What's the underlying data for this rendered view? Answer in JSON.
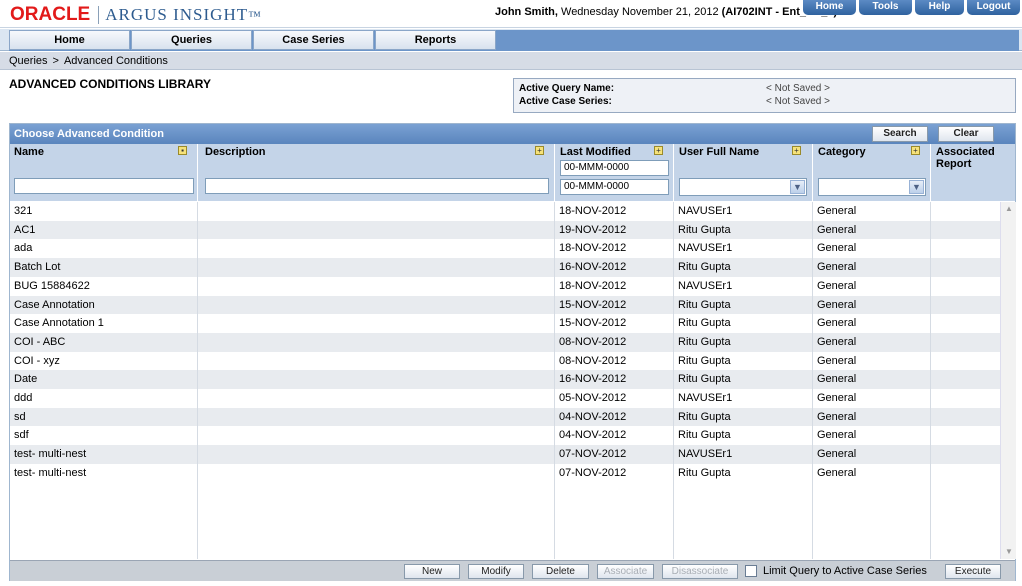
{
  "header": {
    "logo_oracle": "ORACLE",
    "logo_product": "ARGUS INSIGHT",
    "logo_tm": "™",
    "user_name": "John Smith,",
    "user_session": " Wednesday November 21, 2012 ",
    "user_env": "(AI702INT - Ent_SH_2)",
    "links": [
      "Home",
      "Tools",
      "Help",
      "Logout"
    ]
  },
  "nav": {
    "tabs": [
      "Home",
      "Queries",
      "Case Series",
      "Reports"
    ]
  },
  "breadcrumb": {
    "items": [
      "Queries",
      "Advanced Conditions"
    ],
    "separator": ">"
  },
  "page": {
    "title": "ADVANCED CONDITIONS LIBRARY"
  },
  "active_info": {
    "query_label": "Active Query Name:",
    "query_value": "< Not Saved >",
    "case_label": "Active Case Series:",
    "case_value": "< Not Saved >"
  },
  "panel": {
    "title": "Choose Advanced Condition",
    "search_label": "Search",
    "clear_label": "Clear"
  },
  "columns": {
    "name": "Name",
    "description": "Description",
    "last_modified": "Last Modified",
    "user_full_name": "User Full Name",
    "category": "Category",
    "associated_report_1": "Associated",
    "associated_report_2": "Report"
  },
  "filters": {
    "name_value": "",
    "description_value": "",
    "date_from": "00-MMM-0000",
    "date_to": "00-MMM-0000",
    "user_selected": "",
    "category_selected": ""
  },
  "rows": [
    {
      "name": "321",
      "description": "",
      "modified": "18-NOV-2012",
      "user": "NAVUSEr1",
      "category": "General",
      "report": ""
    },
    {
      "name": "AC1",
      "description": "",
      "modified": "19-NOV-2012",
      "user": "Ritu Gupta",
      "category": "General",
      "report": ""
    },
    {
      "name": "ada",
      "description": "",
      "modified": "18-NOV-2012",
      "user": "NAVUSEr1",
      "category": "General",
      "report": ""
    },
    {
      "name": "Batch Lot",
      "description": "",
      "modified": "16-NOV-2012",
      "user": "Ritu Gupta",
      "category": "General",
      "report": ""
    },
    {
      "name": "BUG 15884622",
      "description": "",
      "modified": "18-NOV-2012",
      "user": "NAVUSEr1",
      "category": "General",
      "report": ""
    },
    {
      "name": "Case Annotation",
      "description": "",
      "modified": "15-NOV-2012",
      "user": "Ritu Gupta",
      "category": "General",
      "report": ""
    },
    {
      "name": "Case Annotation 1",
      "description": "",
      "modified": "15-NOV-2012",
      "user": "Ritu Gupta",
      "category": "General",
      "report": ""
    },
    {
      "name": "COI - ABC",
      "description": "",
      "modified": "08-NOV-2012",
      "user": "Ritu Gupta",
      "category": "General",
      "report": ""
    },
    {
      "name": "COI - xyz",
      "description": "",
      "modified": "08-NOV-2012",
      "user": "Ritu Gupta",
      "category": "General",
      "report": ""
    },
    {
      "name": "Date",
      "description": "",
      "modified": "16-NOV-2012",
      "user": "Ritu Gupta",
      "category": "General",
      "report": ""
    },
    {
      "name": "ddd",
      "description": "",
      "modified": "05-NOV-2012",
      "user": "NAVUSEr1",
      "category": "General",
      "report": ""
    },
    {
      "name": "sd",
      "description": "",
      "modified": "04-NOV-2012",
      "user": "Ritu Gupta",
      "category": "General",
      "report": ""
    },
    {
      "name": "sdf",
      "description": "",
      "modified": "04-NOV-2012",
      "user": "Ritu Gupta",
      "category": "General",
      "report": ""
    },
    {
      "name": "test- multi-nest",
      "description": "",
      "modified": "07-NOV-2012",
      "user": "NAVUSEr1",
      "category": "General",
      "report": ""
    },
    {
      "name": "test- multi-nest",
      "description": "",
      "modified": "07-NOV-2012",
      "user": "Ritu Gupta",
      "category": "General",
      "report": ""
    }
  ],
  "footer": {
    "new_label": "New",
    "modify_label": "Modify",
    "delete_label": "Delete",
    "associate_label": "Associate",
    "disassociate_label": "Disassociate",
    "limit_label": "Limit Query to Active Case Series",
    "limit_checked": false,
    "execute_label": "Execute"
  },
  "colors": {
    "oracle_red": "#e21a1a",
    "panel_header": "#5a85bd",
    "column_header": "#c4d4e8",
    "alt_row": "#e8ebef"
  }
}
